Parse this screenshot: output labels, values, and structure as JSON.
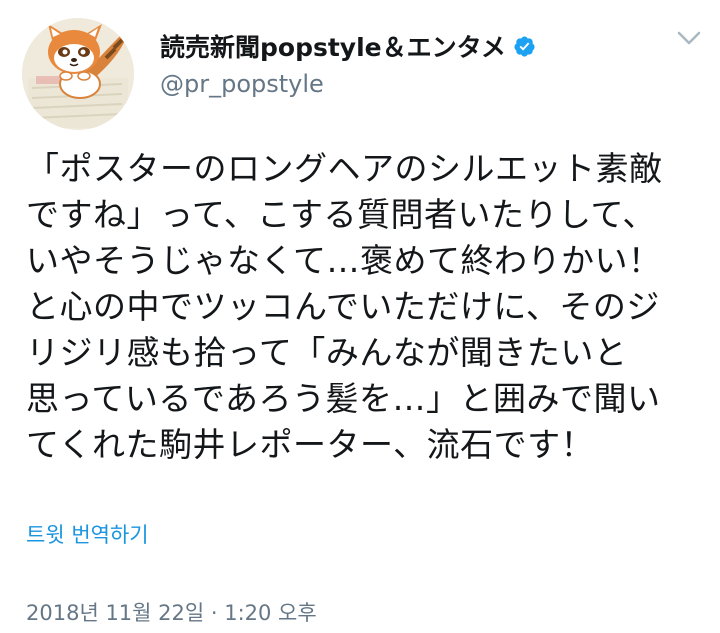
{
  "user": {
    "display_name": "読売新聞popstyle＆エンタメ",
    "handle": "@pr_popstyle",
    "verified": true,
    "avatar_icon": "raccoon-mascot-avatar"
  },
  "tweet": {
    "text_lines": [
      "「ポスターのロングヘアのシルエット素敵",
      "ですね」って、こする質問者いたりして、",
      "いやそうじゃなくて…褒めて終わりかい！",
      "と心の中でツッコんでいただけに、そのジ",
      "リジリ感も拾って「みんなが聞きたいと",
      "思っているであろう髪を…」と囲みで聞い",
      "てくれた駒井レポーター、流石です！"
    ],
    "translate_label": "트윗 번역하기",
    "timestamp": "2018년 11월 22일 · 1:20 오후"
  },
  "colors": {
    "text": "#14171a",
    "secondary": "#657786",
    "link": "#1b95e0",
    "verified": "#1da1f2"
  }
}
